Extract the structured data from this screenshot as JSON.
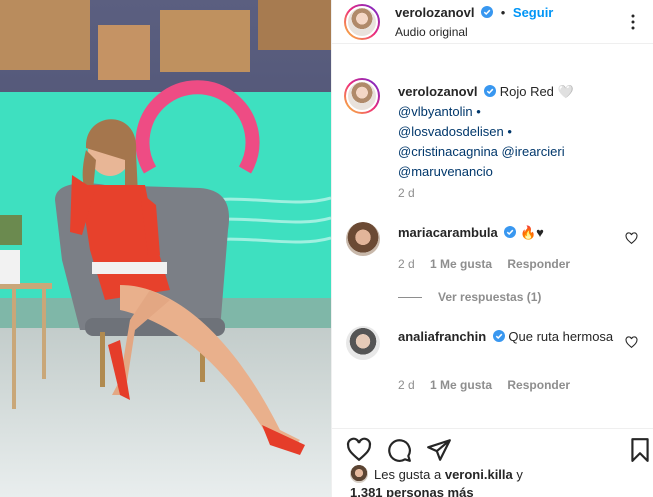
{
  "post": {
    "author": "verolozanovl",
    "follow_label": "Seguir",
    "dot": "•",
    "audio": "Audio original"
  },
  "caption": {
    "author": "verolozanovl",
    "text": "Rojo Red 🤍",
    "mentions": [
      "@vlbyantolin",
      "@losvadosdelisen",
      "@cristinacagnina",
      "@irearcieri",
      "@maruvenancio"
    ],
    "separator": "•",
    "time": "2 d"
  },
  "comments": [
    {
      "author": "mariacarambula",
      "text": "🔥♥",
      "time": "2 d",
      "likes_label": "1 Me gusta",
      "reply_label": "Responder",
      "replies_label": "Ver respuestas (1)"
    },
    {
      "author": "analiafranchin",
      "text": "Que ruta hermosa",
      "time": "2 d",
      "likes_label": "1 Me gusta",
      "reply_label": "Responder"
    }
  ],
  "likes": {
    "prefix": "Les gusta a",
    "user": "veroni.killa",
    "conj": "y",
    "others": "1,381 personas más"
  },
  "icons": {
    "verified": "verified-badge-icon",
    "more": "more-options-icon",
    "like": "heart-icon",
    "comment": "comment-icon",
    "share": "share-icon",
    "save": "bookmark-icon"
  },
  "colors": {
    "accent": "#0095f6",
    "verified": "#3897f0",
    "mention": "#00376b",
    "muted": "#8e8e8e"
  }
}
